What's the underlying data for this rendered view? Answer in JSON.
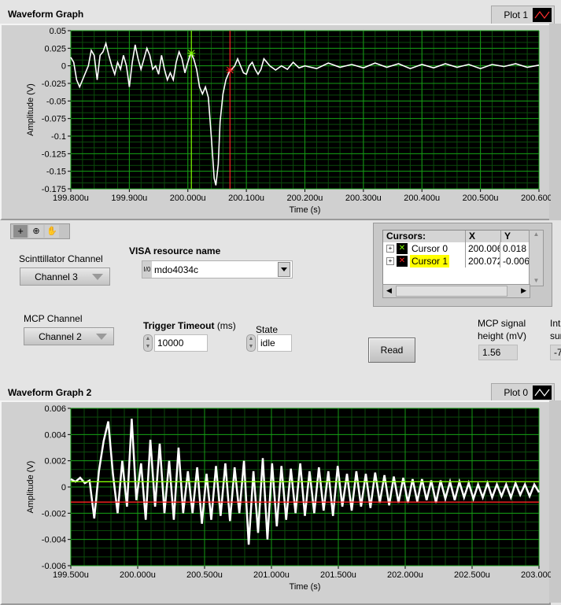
{
  "graph1": {
    "title": "Waveform Graph",
    "legend_label": "Plot 1",
    "legend_color": "#ff3030",
    "cursor0_x": 200.006,
    "cursor0_y": 0.018,
    "cursor1_x": 200.072,
    "cursor1_y": -0.006
  },
  "graph2": {
    "title": "Waveform Graph 2",
    "legend_label": "Plot 0",
    "legend_color": "#ffffff",
    "cursor_green_y": 0.0004,
    "cursor_red_y": -0.00115
  },
  "chart_data": [
    {
      "type": "line",
      "title": "Waveform Graph",
      "xlabel": "Time (s)",
      "ylabel": "Amplitude (V)",
      "xlim": [
        199.8,
        200.6
      ],
      "ylim": [
        -0.175,
        0.05
      ],
      "grid": true,
      "xticks": [
        199.8,
        199.9,
        200.0,
        200.1,
        200.2,
        200.3,
        200.4,
        200.5,
        200.6
      ],
      "xtick_labels": [
        "199.800u",
        "199.900u",
        "200.000u",
        "200.100u",
        "200.200u",
        "200.300u",
        "200.400u",
        "200.500u",
        "200.600u"
      ],
      "yticks": [
        0.05,
        0.025,
        0,
        -0.025,
        -0.05,
        -0.075,
        -0.1,
        -0.125,
        -0.15,
        -0.175
      ],
      "ytick_labels": [
        "0.05",
        "0.025",
        "0",
        "-0.025",
        "-0.05",
        "-0.075",
        "-0.1",
        "-0.125",
        "-0.15",
        "-0.175"
      ],
      "series": [
        {
          "name": "Plot 1",
          "x": [
            199.8,
            199.805,
            199.81,
            199.815,
            199.82,
            199.825,
            199.83,
            199.835,
            199.84,
            199.845,
            199.85,
            199.855,
            199.86,
            199.865,
            199.87,
            199.875,
            199.88,
            199.885,
            199.89,
            199.895,
            199.9,
            199.905,
            199.91,
            199.915,
            199.92,
            199.925,
            199.93,
            199.935,
            199.94,
            199.945,
            199.95,
            199.955,
            199.96,
            199.965,
            199.97,
            199.975,
            199.98,
            199.985,
            199.99,
            199.995,
            200.0,
            200.005,
            200.01,
            200.015,
            200.02,
            200.025,
            200.03,
            200.035,
            200.04,
            200.045,
            200.048,
            200.052,
            200.055,
            200.06,
            200.065,
            200.07,
            200.075,
            200.08,
            200.085,
            200.09,
            200.095,
            200.1,
            200.105,
            200.11,
            200.115,
            200.12,
            200.125,
            200.13,
            200.135,
            200.14,
            200.15,
            200.16,
            200.17,
            200.18,
            200.19,
            200.2,
            200.22,
            200.24,
            200.26,
            200.28,
            200.3,
            200.32,
            200.34,
            200.36,
            200.38,
            200.4,
            200.42,
            200.44,
            200.46,
            200.48,
            200.5,
            200.52,
            200.54,
            200.56,
            200.58,
            200.6
          ],
          "y": [
            0.012,
            0.005,
            -0.02,
            -0.03,
            -0.02,
            -0.01,
            0.0,
            0.022,
            0.015,
            -0.02,
            0.015,
            0.02,
            0.032,
            0.015,
            0.0,
            -0.012,
            0.005,
            -0.005,
            0.015,
            0.0,
            -0.03,
            0.005,
            0.03,
            0.01,
            -0.005,
            0.01,
            0.025,
            0.015,
            -0.005,
            0.0,
            -0.012,
            0.015,
            -0.005,
            -0.02,
            -0.01,
            -0.02,
            0.005,
            0.02,
            0.01,
            -0.01,
            0.005,
            0.018,
            0.01,
            -0.005,
            -0.03,
            -0.04,
            -0.03,
            -0.045,
            -0.1,
            -0.16,
            -0.17,
            -0.14,
            -0.08,
            -0.04,
            -0.02,
            -0.01,
            -0.005,
            0.0,
            0.01,
            0.0,
            -0.01,
            -0.012,
            0.0,
            0.005,
            -0.005,
            -0.012,
            -0.005,
            0.01,
            0.005,
            0.0,
            -0.006,
            0.0,
            -0.005,
            0.005,
            -0.003,
            0.0,
            -0.004,
            0.004,
            -0.002,
            0.002,
            -0.003,
            0.004,
            -0.002,
            0.003,
            -0.004,
            0.002,
            -0.003,
            0.003,
            -0.002,
            0.002,
            -0.004,
            0.002,
            -0.001,
            0.003,
            -0.002,
            0.001
          ]
        }
      ],
      "cursors": [
        {
          "name": "Cursor 0",
          "x": 200.006,
          "y": 0.018,
          "color": "#80ff00"
        },
        {
          "name": "Cursor 1",
          "x": 200.072,
          "y": -0.006,
          "color": "#ff2020"
        }
      ]
    },
    {
      "type": "line",
      "title": "Waveform Graph 2",
      "xlabel": "Time (s)",
      "ylabel": "Amplitude (V)",
      "xlim": [
        199.5,
        203.0
      ],
      "ylim": [
        -0.006,
        0.006
      ],
      "grid": true,
      "xticks": [
        199.5,
        200.0,
        200.5,
        201.0,
        201.5,
        202.0,
        202.5,
        203.0
      ],
      "xtick_labels": [
        "199.500u",
        "200.000u",
        "200.500u",
        "201.000u",
        "201.500u",
        "202.000u",
        "202.500u",
        "203.000u"
      ],
      "yticks": [
        0.006,
        0.004,
        0.002,
        0,
        -0.002,
        -0.004,
        -0.006
      ],
      "ytick_labels": [
        "0.006",
        "0.004",
        "0.002",
        "0",
        "-0.002",
        "-0.004",
        "-0.006"
      ],
      "x_start": 199.5,
      "x_step": 0.035,
      "series": [
        {
          "name": "Plot 0",
          "y": [
            0.0006,
            0.0004,
            0.0007,
            0.0003,
            0.0005,
            -0.0024,
            0.0012,
            0.0035,
            0.005,
            0.001,
            -0.002,
            0.002,
            -0.0015,
            0.0052,
            -0.001,
            0.0018,
            -0.0025,
            0.0036,
            -0.0015,
            0.0033,
            -0.002,
            0.002,
            -0.0025,
            0.003,
            -0.002,
            0.0012,
            -0.002,
            0.0015,
            -0.0028,
            0.001,
            -0.0025,
            0.0016,
            -0.0022,
            0.0018,
            -0.0026,
            0.0015,
            -0.002,
            0.002,
            -0.0044,
            0.0012,
            -0.0035,
            0.0022,
            -0.004,
            0.0018,
            -0.003,
            0.0016,
            -0.0025,
            0.0014,
            -0.002,
            0.0018,
            -0.0022,
            0.0012,
            -0.002,
            0.0015,
            -0.0018,
            0.0012,
            -0.0022,
            0.0016,
            -0.0015,
            0.001,
            -0.0018,
            0.0012,
            -0.0015,
            0.001,
            -0.0016,
            0.0011,
            -0.0012,
            0.0009,
            -0.0014,
            0.0008,
            -0.0012,
            0.0007,
            -0.0012,
            0.0006,
            -0.0011,
            0.0006,
            -0.001,
            0.0005,
            -0.0012,
            0.0005,
            -0.0009,
            0.0004,
            -0.001,
            0.0004,
            -0.0008,
            0.0003,
            -0.0009,
            0.0002,
            -0.0008,
            0.0003,
            -0.0008,
            0.0002,
            -0.0007,
            0.0002,
            -0.0008,
            0.0003,
            -0.0006,
            0.0002,
            -0.0007,
            0.0002,
            -0.0004
          ]
        }
      ],
      "cursors": [
        {
          "y": 0.0004,
          "color": "#80ff00"
        },
        {
          "y": -0.00115,
          "color": "#ff2020"
        }
      ]
    }
  ],
  "controls": {
    "scintillator_label": "Scinttillator Channel",
    "scintillator_value": "Channel 3",
    "visa_label": "VISA resource name",
    "visa_prefix": "I/0",
    "visa_value": "mdo4034c",
    "mcp_label": "MCP Channel",
    "mcp_value": "Channel 2",
    "trigger_label": "Trigger Timeout",
    "trigger_unit": "(ms)",
    "trigger_value": "10000",
    "state_label": "State",
    "state_value": "idle",
    "read_button": "Read",
    "mcp_height_label_1": "MCP signal",
    "mcp_height_label_2": "height (mV)",
    "mcp_height_value": "1.56",
    "int_label_1": "Int",
    "int_label_2": "sur",
    "int_value": "-7"
  },
  "cursor_legend": {
    "headers": [
      "Cursors:",
      "X",
      "Y"
    ],
    "rows": [
      {
        "name": "Cursor 0",
        "x": "200.006",
        "y": "0.018",
        "color": "#80ff00",
        "highlight": false
      },
      {
        "name": "Cursor 1",
        "x": "200.072",
        "y": "-0.006",
        "color": "#ff2020",
        "highlight": true
      }
    ]
  }
}
